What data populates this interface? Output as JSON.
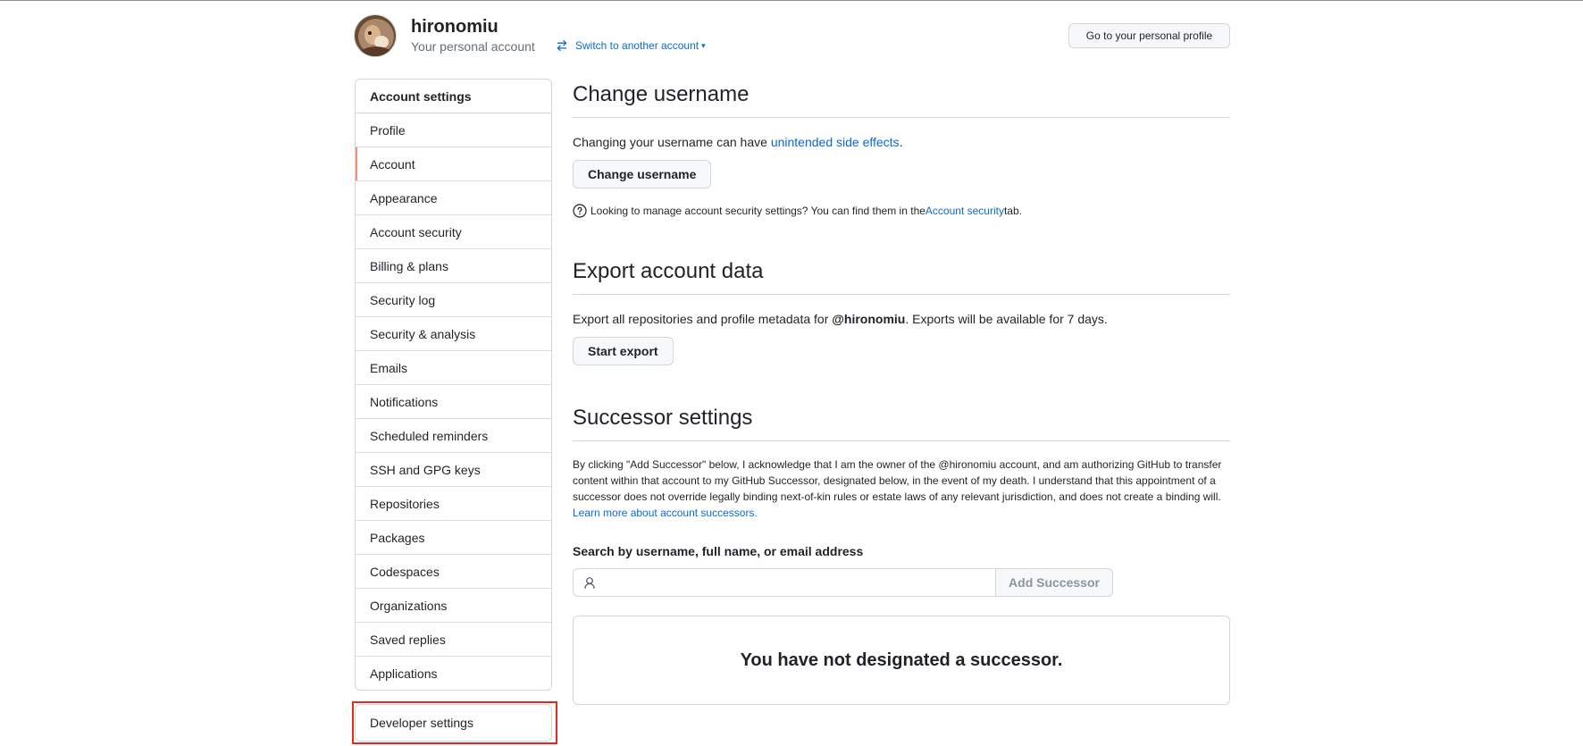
{
  "header": {
    "username": "hironomiu",
    "account_type": "Your personal account",
    "switch_label": "Switch to another account",
    "profile_button": "Go to your personal profile"
  },
  "sidebar": {
    "heading": "Account settings",
    "items": [
      {
        "label": "Profile",
        "active": false
      },
      {
        "label": "Account",
        "active": true
      },
      {
        "label": "Appearance",
        "active": false
      },
      {
        "label": "Account security",
        "active": false
      },
      {
        "label": "Billing & plans",
        "active": false
      },
      {
        "label": "Security log",
        "active": false
      },
      {
        "label": "Security & analysis",
        "active": false
      },
      {
        "label": "Emails",
        "active": false
      },
      {
        "label": "Notifications",
        "active": false
      },
      {
        "label": "Scheduled reminders",
        "active": false
      },
      {
        "label": "SSH and GPG keys",
        "active": false
      },
      {
        "label": "Repositories",
        "active": false
      },
      {
        "label": "Packages",
        "active": false
      },
      {
        "label": "Codespaces",
        "active": false
      },
      {
        "label": "Organizations",
        "active": false
      },
      {
        "label": "Saved replies",
        "active": false
      },
      {
        "label": "Applications",
        "active": false
      }
    ],
    "developer_settings": "Developer settings"
  },
  "change_username": {
    "title": "Change username",
    "text_before": "Changing your username can have ",
    "link": "unintended side effects",
    "text_after": ".",
    "button": "Change username",
    "note_before": "Looking to manage account security settings? You can find them in the ",
    "note_link": "Account security",
    "note_after": " tab."
  },
  "export": {
    "title": "Export account data",
    "text_before": "Export all repositories and profile metadata for ",
    "handle": "@hironomiu",
    "text_after": ". Exports will be available for 7 days.",
    "button": "Start export"
  },
  "successor": {
    "title": "Successor settings",
    "legal_text": "By clicking \"Add Successor\" below, I acknowledge that I am the owner of the @hironomiu account, and am authorizing GitHub to transfer content within that account to my GitHub Successor, designated below, in the event of my death. I understand that this appointment of a successor does not override legally binding next-of-kin rules or estate laws of any relevant jurisdiction, and does not create a binding will. ",
    "learn_more": "Learn more about account successors.",
    "search_label": "Search by username, full name, or email address",
    "search_value": "",
    "add_button": "Add Successor",
    "empty_message": "You have not designated a successor."
  },
  "colors": {
    "link": "#0969da",
    "border": "#d0d7de",
    "active_indicator": "#fd8c73",
    "highlight": "#e8281c"
  }
}
